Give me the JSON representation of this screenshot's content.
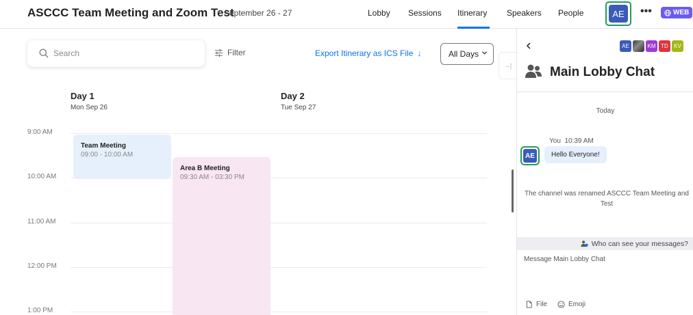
{
  "header": {
    "event_title": "ASCCC Team Meeting and Zoom Test",
    "separator": "•",
    "event_dates": "September 26 - 27",
    "nav": [
      {
        "label": "Lobby"
      },
      {
        "label": "Sessions"
      },
      {
        "label": "Itinerary",
        "active": true
      },
      {
        "label": "Speakers"
      },
      {
        "label": "People"
      }
    ],
    "user_initials": "AE",
    "more_icon": "•••",
    "web_badge": "WEB"
  },
  "toolbar": {
    "search_placeholder": "Search",
    "filter_label": "Filter",
    "export_label": "Export Itinerary as ICS File",
    "export_icon": "↓",
    "days_select": "All Days",
    "collapse_icon": "→|"
  },
  "calendar": {
    "days": [
      {
        "title": "Day 1",
        "date": "Mon Sep 26"
      },
      {
        "title": "Day 2",
        "date": "Tue Sep 27"
      }
    ],
    "times": [
      "9:00 AM",
      "10:00 AM",
      "11:00 AM",
      "12:00 PM",
      "1:00 PM"
    ],
    "events": [
      {
        "title": "Team Meeting",
        "time": "09:00 - 10:00 AM",
        "color": "#e6f0fc"
      },
      {
        "title": "Area B Meeting",
        "time": "09:30 AM - 03:30 PM",
        "color": "#f8e6f3"
      }
    ]
  },
  "chat": {
    "title": "Main Lobby Chat",
    "participants": [
      {
        "initials": "AE",
        "color": "#3b5bb8"
      },
      {
        "initials": "",
        "color": "#555555",
        "photo": true
      },
      {
        "initials": "KM",
        "color": "#a03ad4"
      },
      {
        "initials": "TD",
        "color": "#e0343c"
      },
      {
        "initials": "KV",
        "color": "#a2b816"
      }
    ],
    "today_label": "Today",
    "message": {
      "sender": "You",
      "time": "10:39 AM",
      "initials": "AE",
      "text": "Hello Everyone!"
    },
    "system_message": "The channel was renamed ASCCC Team Meeting and Test",
    "visibility_label": "Who can see your messages?",
    "input_placeholder": "Message Main Lobby Chat",
    "file_label": "File",
    "emoji_label": "Emoji"
  },
  "colors": {
    "accent": "#0e72ed",
    "avatar_blue": "#3b5bb8",
    "avatar_ring": "#1f9d55",
    "web_badge": "#6b5bf0"
  }
}
